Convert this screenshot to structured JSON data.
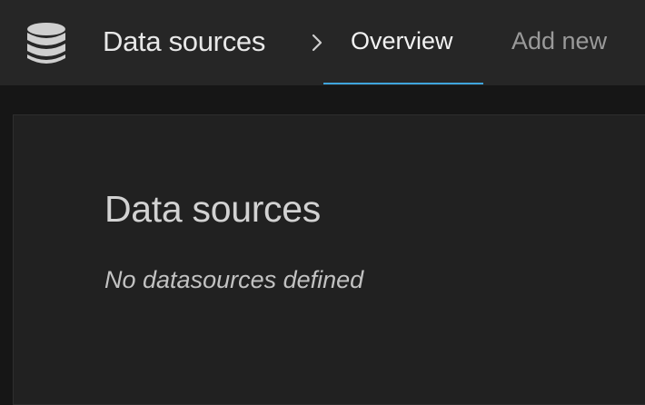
{
  "header": {
    "icon": "database-icon",
    "title": "Data sources",
    "separator_icon": "chevron-right-icon",
    "tabs": [
      {
        "label": "Overview",
        "active": true
      },
      {
        "label": "Add new",
        "active": false
      }
    ],
    "active_tab_color": "#3fa4dc"
  },
  "main": {
    "heading": "Data sources",
    "empty_message": "No datasources defined"
  }
}
